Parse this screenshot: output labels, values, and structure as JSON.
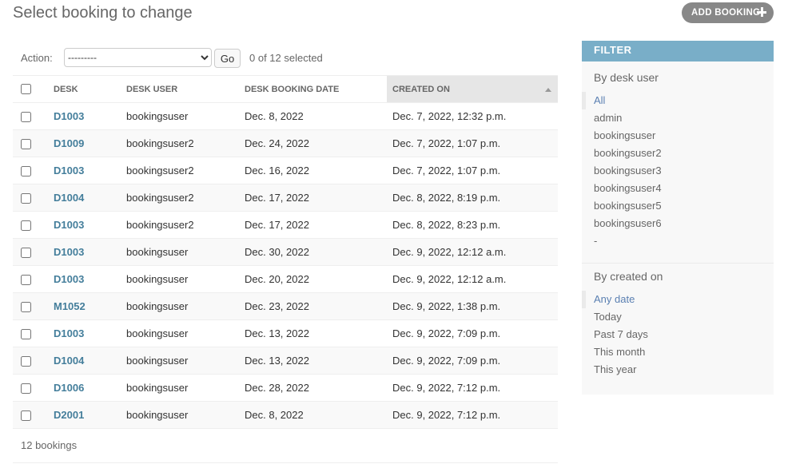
{
  "page": {
    "title": "Select booking to change",
    "add_label": "ADD BOOKING"
  },
  "actions": {
    "label": "Action:",
    "selected": "---------",
    "go_label": "Go",
    "selection_count": "0 of 12 selected"
  },
  "table": {
    "headers": [
      "DESK",
      "DESK USER",
      "DESK BOOKING DATE",
      "CREATED ON"
    ],
    "rows": [
      {
        "desk": "D1003",
        "user": "bookingsuser",
        "date": "Dec. 8, 2022",
        "created": "Dec. 7, 2022, 12:32 p.m."
      },
      {
        "desk": "D1009",
        "user": "bookingsuser2",
        "date": "Dec. 24, 2022",
        "created": "Dec. 7, 2022, 1:07 p.m."
      },
      {
        "desk": "D1003",
        "user": "bookingsuser2",
        "date": "Dec. 16, 2022",
        "created": "Dec. 7, 2022, 1:07 p.m."
      },
      {
        "desk": "D1004",
        "user": "bookingsuser2",
        "date": "Dec. 17, 2022",
        "created": "Dec. 8, 2022, 8:19 p.m."
      },
      {
        "desk": "D1003",
        "user": "bookingsuser2",
        "date": "Dec. 17, 2022",
        "created": "Dec. 8, 2022, 8:23 p.m."
      },
      {
        "desk": "D1003",
        "user": "bookingsuser",
        "date": "Dec. 30, 2022",
        "created": "Dec. 9, 2022, 12:12 a.m."
      },
      {
        "desk": "D1003",
        "user": "bookingsuser",
        "date": "Dec. 20, 2022",
        "created": "Dec. 9, 2022, 12:12 a.m."
      },
      {
        "desk": "M1052",
        "user": "bookingsuser",
        "date": "Dec. 23, 2022",
        "created": "Dec. 9, 2022, 1:38 p.m."
      },
      {
        "desk": "D1003",
        "user": "bookingsuser",
        "date": "Dec. 13, 2022",
        "created": "Dec. 9, 2022, 7:09 p.m."
      },
      {
        "desk": "D1004",
        "user": "bookingsuser",
        "date": "Dec. 13, 2022",
        "created": "Dec. 9, 2022, 7:09 p.m."
      },
      {
        "desk": "D1006",
        "user": "bookingsuser",
        "date": "Dec. 28, 2022",
        "created": "Dec. 9, 2022, 7:12 p.m."
      },
      {
        "desk": "D2001",
        "user": "bookingsuser",
        "date": "Dec. 8, 2022",
        "created": "Dec. 9, 2022, 7:12 p.m."
      }
    ]
  },
  "paginator": {
    "text": "12 bookings"
  },
  "filter": {
    "title": "FILTER",
    "groups": [
      {
        "title": "By desk user",
        "items": [
          "All",
          "admin",
          "bookingsuser",
          "bookingsuser2",
          "bookingsuser3",
          "bookingsuser4",
          "bookingsuser5",
          "bookingsuser6",
          "-"
        ]
      },
      {
        "title": "By created on",
        "items": [
          "Any date",
          "Today",
          "Past 7 days",
          "This month",
          "This year"
        ]
      }
    ]
  },
  "colors": {
    "link": "#447e9b",
    "filter_header": "#79aec8",
    "selected_filter": "#5b80b2",
    "button": "#888888"
  }
}
